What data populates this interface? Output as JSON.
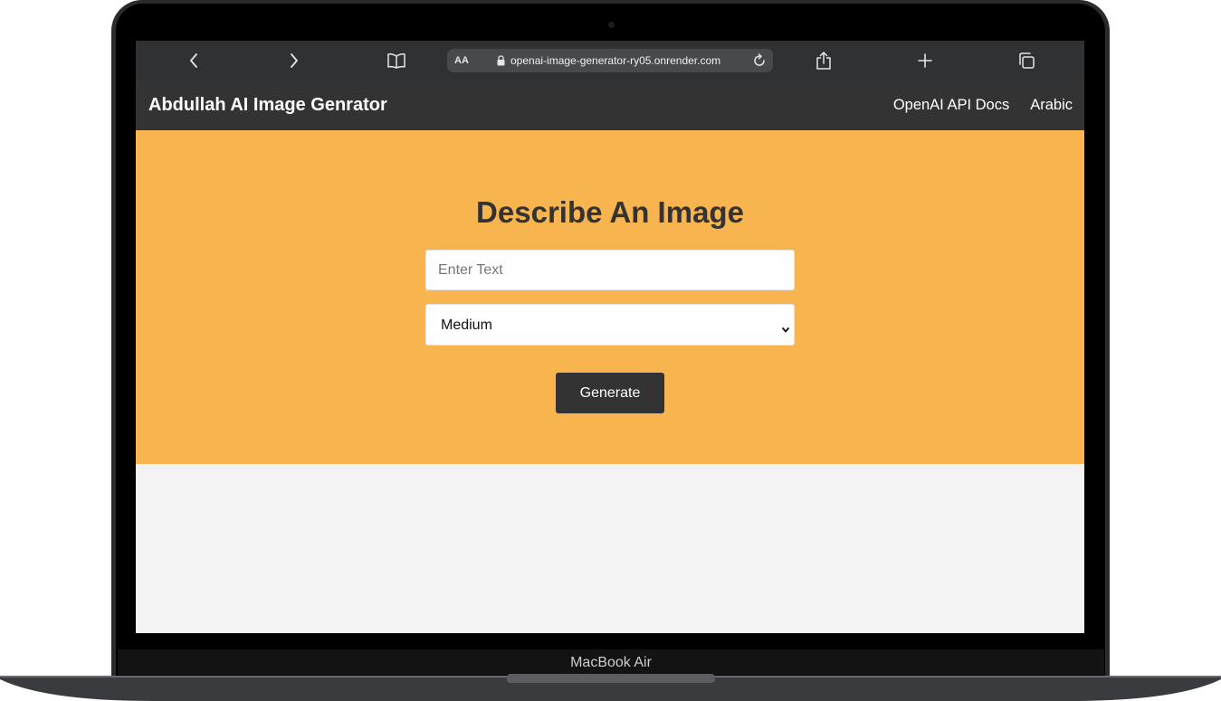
{
  "device": {
    "model_label": "MacBook Air"
  },
  "browser": {
    "text_size_label": "AA",
    "url": "openai-image-generator-ry05.onrender.com",
    "icons": [
      "back-icon",
      "forward-icon",
      "bookmarks-icon",
      "lock-icon",
      "reload-icon",
      "share-icon",
      "new-tab-icon",
      "tabs-icon"
    ]
  },
  "navbar": {
    "brand": "Abdullah AI Image Genrator",
    "links": [
      "OpenAI API Docs",
      "Arabic"
    ]
  },
  "hero": {
    "title": "Describe An Image",
    "prompt_placeholder": "Enter Text",
    "size_selected": "Medium",
    "generate_label": "Generate"
  },
  "colors": {
    "navbar": "#333333",
    "hero": "#f7b44f",
    "page_background": "#f3f3f3",
    "button": "#333333",
    "browser_toolbar": "#2f3133"
  }
}
